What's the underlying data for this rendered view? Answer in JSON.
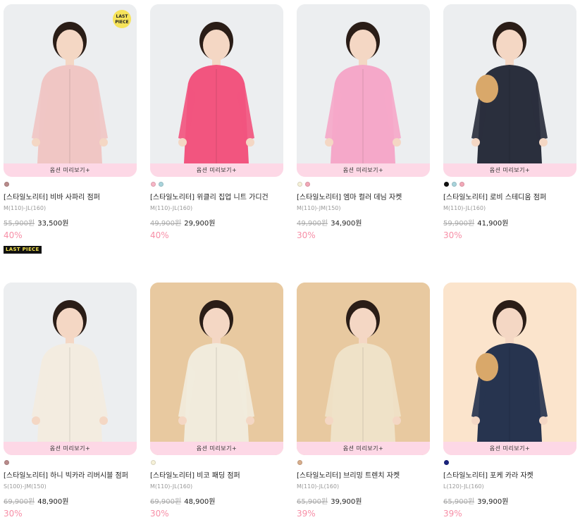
{
  "preview_label": "옵션 미리보기+",
  "last_piece_badge": "LAST\nPIECE",
  "last_piece_tag": "LAST PIECE",
  "products": [
    {
      "name": "[스타일노리터] 비바 사파리 점퍼",
      "size": "M(110)-JL(160)",
      "original_price": "55,900원",
      "sale_price": "33,500원",
      "discount": "40%",
      "bg": "#eceef0",
      "outfit": "#f0c6c4",
      "swatches": [
        "#b98b8b"
      ],
      "icon": "safari-jacket-photo"
    },
    {
      "name": "[스타일노리터] 위클리 집업 니트 가디건",
      "size": "M(110)-JL(160)",
      "original_price": "49,900원",
      "sale_price": "29,900원",
      "discount": "40%",
      "bg": "#eceef0",
      "outfit": "#f2557f",
      "swatches": [
        "#f7b6c6",
        "#a9d4dc"
      ],
      "icon": "knit-cardigan-photo"
    },
    {
      "name": "[스타일노리터] 엠마 컬러 데님 자켓",
      "size": "M(110)-JM(150)",
      "original_price": "49,900원",
      "sale_price": "34,900원",
      "discount": "30%",
      "bg": "#eceef0",
      "outfit": "#f5a8c9",
      "swatches": [
        "#f6f1d8",
        "#f3a8b8"
      ],
      "icon": "denim-jacket-photo"
    },
    {
      "name": "[스타일노리터] 로비 스테디움 점퍼",
      "size": "M(110)-JL(160)",
      "original_price": "59,900원",
      "sale_price": "41,900원",
      "discount": "30%",
      "bg": "#eceef0",
      "outfit": "#2a2f3d",
      "swatches": [
        "#111111",
        "#a9d4dc",
        "#f3a8b8"
      ],
      "icon": "stadium-jumper-photo"
    },
    {
      "name": "[스타일노리터] 하니 빅카라 리버시블 점퍼",
      "size": "S(100)-JM(150)",
      "original_price": "69,900원",
      "sale_price": "48,900원",
      "discount": "30%",
      "bg": "#eceef0",
      "outfit": "#f3ece0",
      "swatches": [
        "#b98b8b"
      ],
      "icon": "reversible-jumper-photo"
    },
    {
      "name": "[스타일노리터] 비코 패딩 점퍼",
      "size": "M(110)-JL(160)",
      "original_price": "69,900원",
      "sale_price": "48,900원",
      "discount": "30%",
      "bg": "#e8c9a0",
      "outfit": "#f1ebdc",
      "swatches": [
        "#f6f1d8"
      ],
      "icon": "padding-jumper-photo"
    },
    {
      "name": "[스타일노리터] 브리밍 트렌치 자켓",
      "size": "M(110)-JL(160)",
      "original_price": "65,900원",
      "sale_price": "39,900원",
      "discount": "39%",
      "bg": "#e8c9a0",
      "outfit": "#efe2c8",
      "swatches": [
        "#d8ae8c"
      ],
      "icon": "trench-jacket-photo"
    },
    {
      "name": "[스타일노리터] 포케 카라 자켓",
      "size": "L(120)-JL(160)",
      "original_price": "65,900원",
      "sale_price": "39,900원",
      "discount": "39%",
      "bg": "#fbe4cc",
      "outfit": "#27344f",
      "swatches": [
        "#1a237e"
      ],
      "icon": "collar-jacket-photo"
    }
  ]
}
